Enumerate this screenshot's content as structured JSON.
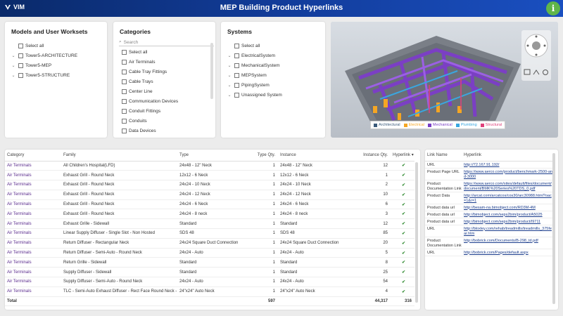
{
  "header": {
    "logo": "VIM",
    "title": "MEP Building Product Hyperlinks",
    "info_icon": "info-icon"
  },
  "models_panel": {
    "title": "Models and User Worksets",
    "items": [
      "Select all",
      "Tower5-ARCHITECTURE",
      "Tower5-MEP",
      "Tower5-STRUCTURE"
    ]
  },
  "categories_panel": {
    "title": "Categories",
    "search_placeholder": "Search",
    "items": [
      "Select all",
      "Air Terminals",
      "Cable Tray Fittings",
      "Cable Trays",
      "Center Line",
      "Communication Devices",
      "Conduit Fittings",
      "Conduits",
      "Data Devices"
    ]
  },
  "systems_panel": {
    "title": "Systems",
    "items": [
      "Select all",
      "ElectricalSystem",
      "MechanicalSystem",
      "MEPSystem",
      "PipingSystem",
      "Unassigned System"
    ]
  },
  "viewer": {
    "legend": [
      {
        "label": "Architectural",
        "color": "#3b5a7a"
      },
      {
        "label": "Electrical",
        "color": "#f5a623"
      },
      {
        "label": "Mechanical",
        "color": "#7b3fc4"
      },
      {
        "label": "Plumbing",
        "color": "#3aa7e0"
      },
      {
        "label": "Structural",
        "color": "#e0407a"
      }
    ]
  },
  "main_table": {
    "columns": [
      "Category",
      "Family",
      "Type",
      "Type Qty.",
      "Instance",
      "Instance Qty.",
      "Hyperlink"
    ],
    "rows": [
      [
        "Air Terminals",
        "All Children's Hospital(LFD)",
        "24x48 - 12\" Neck",
        "1",
        "24x48 - 12\" Neck",
        "12"
      ],
      [
        "Air Terminals",
        "Exhaust Grill - Round Neck",
        "12x12 - 6 Neck",
        "1",
        "12x12 - 6 Neck",
        "1"
      ],
      [
        "Air Terminals",
        "Exhaust Grill - Round Neck",
        "24x24 - 10 Neck",
        "1",
        "24x24 - 10 Neck",
        "2"
      ],
      [
        "Air Terminals",
        "Exhaust Grill - Round Neck",
        "24x24 - 12 Neck",
        "1",
        "24x24 - 12 Neck",
        "10"
      ],
      [
        "Air Terminals",
        "Exhaust Grill - Round Neck",
        "24x24 - 6 Neck",
        "1",
        "24x24 - 6 Neck",
        "6"
      ],
      [
        "Air Terminals",
        "Exhaust Grill - Round Neck",
        "24x24 - 8 neck",
        "1",
        "24x24 - 8 neck",
        "3"
      ],
      [
        "Air Terminals",
        "Exhaust Grille - Sidewall",
        "Standard",
        "1",
        "Standard",
        "12"
      ],
      [
        "Air Terminals",
        "Linear Supply Diffuser - Single Slot - Non Hosted",
        "SDS 48",
        "1",
        "SDS 48",
        "85"
      ],
      [
        "Air Terminals",
        "Return Diffuser - Rectangular Neck",
        "24x24 Square Duct Connection",
        "1",
        "24x24 Square Duct Connection",
        "20"
      ],
      [
        "Air Terminals",
        "Return Diffuser - Semi-Auto - Round Neck",
        "24x24 - Auto",
        "1",
        "24x24 - Auto",
        "5"
      ],
      [
        "Air Terminals",
        "Return Grille - Sidewall",
        "Standard",
        "1",
        "Standard",
        "8"
      ],
      [
        "Air Terminals",
        "Supply Diffuser - Sidewall",
        "Standard",
        "1",
        "Standard",
        "25"
      ],
      [
        "Air Terminals",
        "Supply Diffuser - Semi-Auto - Round Neck",
        "24x24 - Auto",
        "1",
        "24x24 - Auto",
        "54"
      ],
      [
        "Air Terminals",
        "TLC - Semi-Auto Exhaust Diffuser - Rect Face Round Neck - Hosted",
        "24\"x24\" Auto Neck",
        "1",
        "24\"x24\" Auto Neck",
        "4"
      ]
    ],
    "total": {
      "label": "Total",
      "type_qty": "597",
      "instance_qty": "44,317",
      "hyperlink": "316"
    }
  },
  "link_table": {
    "columns": [
      "Link Name",
      "Hyperlink"
    ],
    "rows": [
      [
        "URL",
        "http://72.167.91.192/"
      ],
      [
        "Product Page URL",
        "https://www.aerco.com/product/benchmark-2500-and-3000"
      ],
      [
        "Product Documentation Link",
        "https://www.aerco.com/sites/default/files/document/document/BMK%20Series%20TDS_0.pdf"
      ],
      [
        "Product Data",
        "http://arcat.com/arcatcos/cos30/arc30988.html?oac=1&r=1"
      ],
      [
        "Product data url",
        "http://besam-na.bimobject.com/RD3M-4M"
      ],
      [
        "Product data url",
        "http://bimobject.com/seps2bim/product/A5025"
      ],
      [
        "Product data url",
        "http://bimobject.com/seps2bim/product/I9711"
      ],
      [
        "URL",
        "http://bloxley.com/rehab/treadmills/treadmills_375fear.htm"
      ],
      [
        "Product Documentation Link",
        "http://bobrick.com/Documents/B-298_td.pdf"
      ],
      [
        "URL",
        "http://bobrick.com/Pages/default.aspx"
      ]
    ]
  }
}
